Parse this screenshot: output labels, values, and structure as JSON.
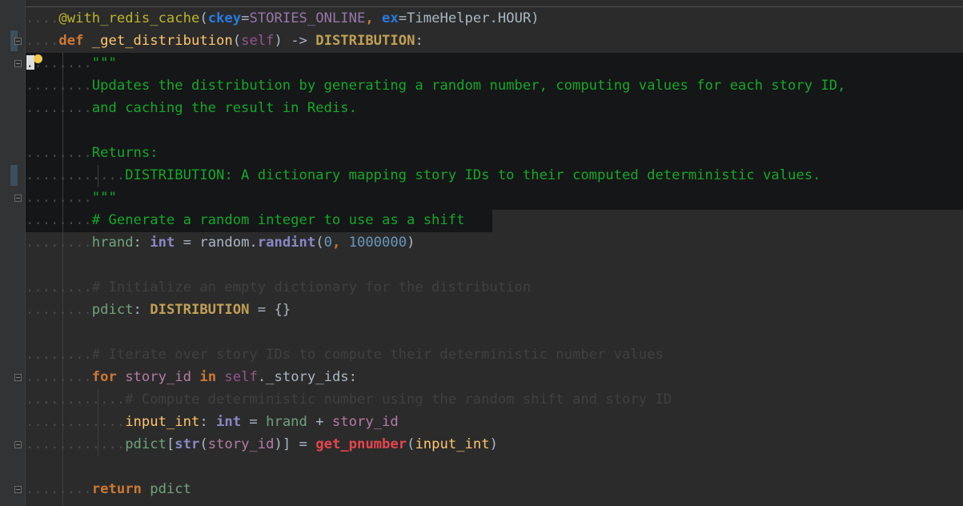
{
  "editor": {
    "language": "python",
    "lines": [
      {
        "ws": "....",
        "tokens": [
          {
            "c": "dec",
            "t": "@with_redis_cache"
          },
          {
            "c": "plain",
            "t": "("
          },
          {
            "c": "ckey",
            "t": "ckey"
          },
          {
            "c": "plain",
            "t": "="
          },
          {
            "c": "const",
            "t": "STORIES_ONLINE"
          },
          {
            "c": "kw",
            "t": ", "
          },
          {
            "c": "ckey",
            "t": "ex"
          },
          {
            "c": "plain",
            "t": "=TimeHelper.HOUR)"
          }
        ]
      },
      {
        "ws": "....",
        "tokens": [
          {
            "c": "kw",
            "t": "def "
          },
          {
            "c": "fn",
            "t": "_get_distribution"
          },
          {
            "c": "plain",
            "t": "("
          },
          {
            "c": "param",
            "t": "self"
          },
          {
            "c": "plain",
            "t": ") -> "
          },
          {
            "c": "typeann",
            "t": "DISTRIBUTION"
          },
          {
            "c": "plain",
            "t": ":"
          }
        ]
      },
      {
        "ws": "........",
        "tokens": [
          {
            "c": "docstr2",
            "t": "\"\"\""
          }
        ]
      },
      {
        "ws": "........",
        "tokens": [
          {
            "c": "docstr2",
            "t": "Updates the distribution by generating a random number, computing values for each story ID,"
          }
        ]
      },
      {
        "ws": "........",
        "tokens": [
          {
            "c": "docstr2",
            "t": "and caching the result in Redis."
          }
        ]
      },
      {
        "ws": "",
        "tokens": []
      },
      {
        "ws": "........",
        "tokens": [
          {
            "c": "docstr2",
            "t": "Returns:"
          }
        ]
      },
      {
        "ws": "............",
        "tokens": [
          {
            "c": "docstr2",
            "t": "DISTRIBUTION: A dictionary mapping story IDs to their computed deterministic values."
          }
        ]
      },
      {
        "ws": "........",
        "tokens": [
          {
            "c": "docstr2",
            "t": "\"\"\""
          }
        ]
      },
      {
        "ws": "........",
        "tokens": [
          {
            "c": "docstr2",
            "t": "# Generate a random integer to use as a shift"
          }
        ]
      },
      {
        "ws": "........",
        "tokens": [
          {
            "c": "var",
            "t": "hrand"
          },
          {
            "c": "plain",
            "t": ": "
          },
          {
            "c": "builtin",
            "t": "int"
          },
          {
            "c": "plain",
            "t": " = random."
          },
          {
            "c": "builtin",
            "t": "randint"
          },
          {
            "c": "plain",
            "t": "("
          },
          {
            "c": "num",
            "t": "0"
          },
          {
            "c": "kw",
            "t": ", "
          },
          {
            "c": "num",
            "t": "1000000"
          },
          {
            "c": "plain",
            "t": ")"
          }
        ]
      },
      {
        "ws": "",
        "tokens": []
      },
      {
        "ws": "........",
        "tokens": [
          {
            "c": "comment-dim",
            "t": "# Initialize an empty dictionary for the distribution"
          }
        ]
      },
      {
        "ws": "........",
        "tokens": [
          {
            "c": "var",
            "t": "pdict"
          },
          {
            "c": "plain",
            "t": ": "
          },
          {
            "c": "typeann",
            "t": "DISTRIBUTION"
          },
          {
            "c": "plain",
            "t": " = {}"
          }
        ]
      },
      {
        "ws": "",
        "tokens": []
      },
      {
        "ws": "........",
        "tokens": [
          {
            "c": "comment-dim",
            "t": "# Iterate over story IDs to compute their deterministic number values"
          }
        ]
      },
      {
        "ws": "........",
        "tokens": [
          {
            "c": "kw",
            "t": "for "
          },
          {
            "c": "local",
            "t": "story_id"
          },
          {
            "c": "kw",
            "t": " in "
          },
          {
            "c": "param",
            "t": "self"
          },
          {
            "c": "plain",
            "t": "._story_ids:"
          }
        ]
      },
      {
        "ws": "............",
        "tokens": [
          {
            "c": "comment-dim",
            "t": "# Compute deterministic number using the random shift and story ID"
          }
        ]
      },
      {
        "ws": "............",
        "tokens": [
          {
            "c": "fn",
            "t": "input_int"
          },
          {
            "c": "plain",
            "t": ": "
          },
          {
            "c": "builtin",
            "t": "int"
          },
          {
            "c": "plain",
            "t": " = "
          },
          {
            "c": "var",
            "t": "hrand"
          },
          {
            "c": "plain",
            "t": " + "
          },
          {
            "c": "local",
            "t": "story_id"
          }
        ]
      },
      {
        "ws": "............",
        "tokens": [
          {
            "c": "var",
            "t": "pdict"
          },
          {
            "c": "plain",
            "t": "["
          },
          {
            "c": "builtin",
            "t": "str"
          },
          {
            "c": "plain",
            "t": "("
          },
          {
            "c": "local",
            "t": "story_id"
          },
          {
            "c": "plain",
            "t": ")] = "
          },
          {
            "c": "red-fn",
            "t": "get_pnumber"
          },
          {
            "c": "plain",
            "t": "("
          },
          {
            "c": "fn",
            "t": "input_int"
          },
          {
            "c": "plain",
            "t": ")"
          }
        ]
      },
      {
        "ws": "",
        "tokens": []
      },
      {
        "ws": "........",
        "tokens": [
          {
            "c": "kw",
            "t": "return "
          },
          {
            "c": "var",
            "t": "pdict"
          }
        ]
      }
    ]
  },
  "gutter_icons": {
    "fold_marker": "fold-icon",
    "intention": "lightbulb-icon"
  }
}
